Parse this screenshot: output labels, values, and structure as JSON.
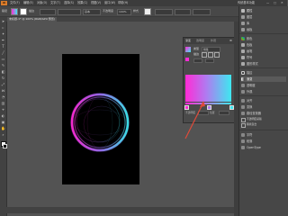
{
  "app": {
    "logo": "Ai",
    "menus": [
      "文件(F)",
      "编辑(E)",
      "对象(O)",
      "文字(T)",
      "选择(S)",
      "效果(C)",
      "视图(V)",
      "窗口(W)",
      "帮助(H)"
    ],
    "workspace_label": "传统基本功能"
  },
  "control_bar": {
    "mode_label": "路径",
    "stroke_label": "描边",
    "style_label": "基本",
    "opacity_label": "不透明度",
    "opacity_value": "100%",
    "style_field": "样式"
  },
  "document_tab": {
    "title": "未标题-1* @ 100% (RGB/GPU 预览)"
  },
  "gradient_panel": {
    "tabs": [
      "渐变",
      "透明度",
      "外观"
    ],
    "type_label": "类型",
    "type_value": "线性",
    "stroke_label": "描边",
    "gradient_start": "#ff2bd6",
    "gradient_mid": "#b07af0",
    "gradient_end": "#3ee8f0",
    "opacity_label": "不透明度",
    "location_label": "位置"
  },
  "right_panel": {
    "items": [
      {
        "label": "属性"
      },
      {
        "label": "图层"
      },
      {
        "label": "库"
      },
      {
        "label": "画板"
      },
      {
        "label": "颜色"
      },
      {
        "label": "色板"
      },
      {
        "label": "画笔"
      },
      {
        "label": "符号"
      },
      {
        "label": "图形样式"
      },
      {
        "label": "描边"
      },
      {
        "label": "渐变"
      },
      {
        "label": "透明度"
      },
      {
        "label": "外观"
      },
      {
        "label": "对齐"
      },
      {
        "label": "变换"
      },
      {
        "label": "路径查找器"
      },
      {
        "label": "字符"
      },
      {
        "label": "段落"
      },
      {
        "label": "OpenType"
      }
    ],
    "checkbox_1": "不透明度蒙版",
    "checkbox_2": "隔离混合"
  },
  "colors": {
    "accent_circle_left": "#ff2bd6",
    "accent_circle_right": "#3ee8f0",
    "annotation_arrow": "#e04a3a"
  }
}
